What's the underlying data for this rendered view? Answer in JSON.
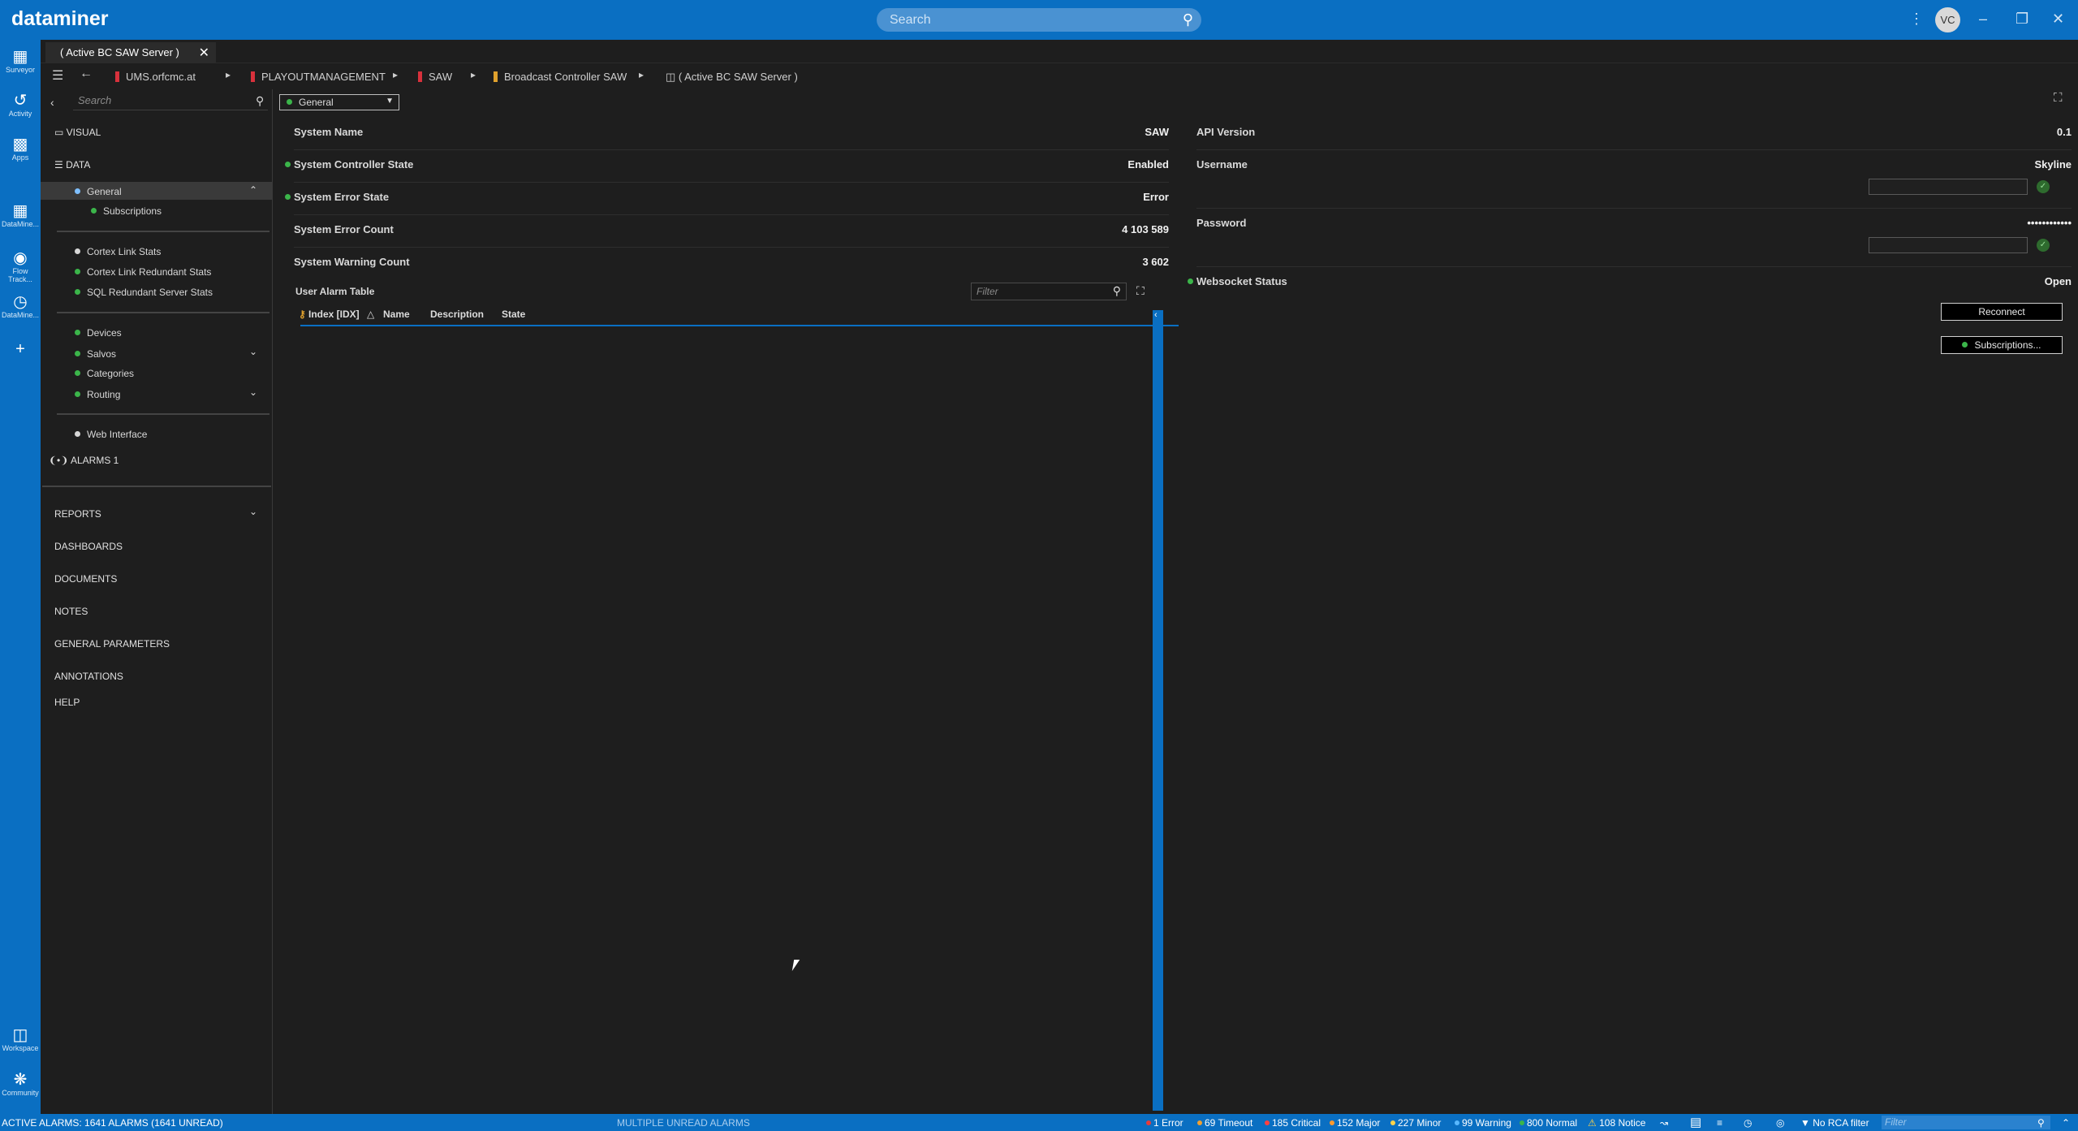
{
  "app": {
    "brand": "dataminer",
    "search_placeholder": "Search",
    "user_initials": "VC"
  },
  "rail": [
    {
      "label": "Surveyor",
      "icon": "surveyor-icon"
    },
    {
      "label": "Activity",
      "icon": "activity-icon"
    },
    {
      "label": "Apps",
      "icon": "apps-icon"
    },
    {
      "label": "DataMine...",
      "icon": "datamine-grid-icon"
    },
    {
      "label": "Flow Track...",
      "icon": "flow-tracking-icon"
    },
    {
      "label": "DataMine...",
      "icon": "datamine-clock-icon"
    },
    {
      "label": "Workspace",
      "icon": "workspace-icon"
    },
    {
      "label": "Community",
      "icon": "community-icon"
    }
  ],
  "tab": {
    "label": "( Active BC SAW Server )"
  },
  "breadcrumb": [
    "UMS.orfcmc.at",
    "PLAYOUTMANAGEMENT",
    "SAW",
    "Broadcast Controller SAW",
    "( Active BC SAW Server )"
  ],
  "sidebar": {
    "search_placeholder": "Search",
    "visual": "VISUAL",
    "data": "DATA",
    "general": "General",
    "subscriptions": "Subscriptions",
    "group1": [
      "Cortex Link Stats",
      "Cortex Link Redundant Stats",
      "SQL Redundant Server Stats"
    ],
    "devices": "Devices",
    "salvos": "Salvos",
    "categories": "Categories",
    "routing": "Routing",
    "web_interface": "Web Interface",
    "alarms": "ALARMS 1",
    "sections": [
      "REPORTS",
      "DASHBOARDS",
      "DOCUMENTS",
      "NOTES",
      "GENERAL PARAMETERS",
      "ANNOTATIONS",
      "HELP"
    ]
  },
  "page": {
    "selector": "General",
    "params": [
      {
        "name": "System Name",
        "value": "SAW"
      },
      {
        "name": "System Controller State",
        "value": "Enabled"
      },
      {
        "name": "System Error State",
        "value": "Error"
      },
      {
        "name": "System Error Count",
        "value": "4 103 589"
      },
      {
        "name": "System Warning Count",
        "value": "3 602"
      }
    ],
    "right": [
      {
        "name": "API Version",
        "value": "0.1"
      },
      {
        "name": "Username",
        "value": "Skyline"
      },
      {
        "name": "Password",
        "value": "••••••••••••"
      },
      {
        "name": "Websocket Status",
        "value": "Open"
      }
    ],
    "reconnect_label": "Reconnect",
    "subscriptions_label": "Subscriptions...",
    "table": {
      "title": "User Alarm Table",
      "filter_placeholder": "Filter",
      "columns": [
        "Index [IDX]",
        "Name",
        "Description",
        "State"
      ]
    }
  },
  "statusbar": {
    "active": "ACTIVE ALARMS: 1641 ALARMS (1641 UNREAD)",
    "multiple": "MULTIPLE UNREAD ALARMS",
    "counts": [
      {
        "label": "1 Error",
        "color": "#e63b3b"
      },
      {
        "label": "69 Timeout",
        "color": "#f0a030"
      },
      {
        "label": "185 Critical",
        "color": "#ff4040"
      },
      {
        "label": "152 Major",
        "color": "#ff9a2e"
      },
      {
        "label": "227 Minor",
        "color": "#ffd34a"
      },
      {
        "label": "99 Warning",
        "color": "#59b8ff"
      },
      {
        "label": "800 Normal",
        "color": "#3bb54a"
      },
      {
        "label": "108 Notice",
        "color": "#ffd34a"
      }
    ],
    "rca": "No RCA filter",
    "filter_placeholder": "Filter"
  }
}
